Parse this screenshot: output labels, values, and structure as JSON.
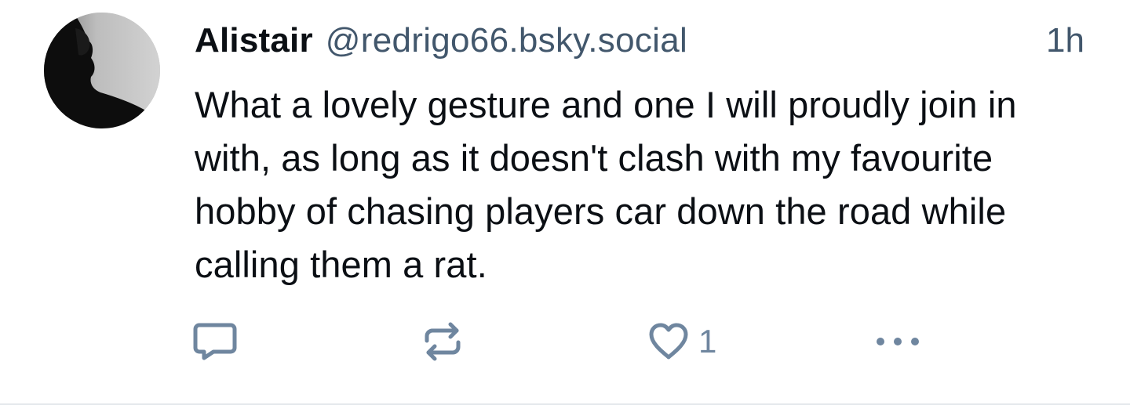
{
  "post": {
    "author": {
      "display_name": "Alistair",
      "handle": "@redrigo66.bsky.social",
      "avatar_icon": "user-avatar-silhouette"
    },
    "timestamp": "1h",
    "text": "What a lovely gesture and one I will proudly join in with, as long as it doesn't clash with my favourite hobby of chasing players car down the road while calling them a rat.",
    "actions": {
      "reply_icon": "reply-bubble-icon",
      "repost_icon": "repost-icon",
      "like_icon": "heart-icon",
      "like_count": "1",
      "more_icon": "more-options-icon"
    }
  },
  "colors": {
    "text_primary": "#0b0f14",
    "text_secondary": "#42576c",
    "icon": "#6f869f",
    "divider": "#e4e8ec"
  }
}
